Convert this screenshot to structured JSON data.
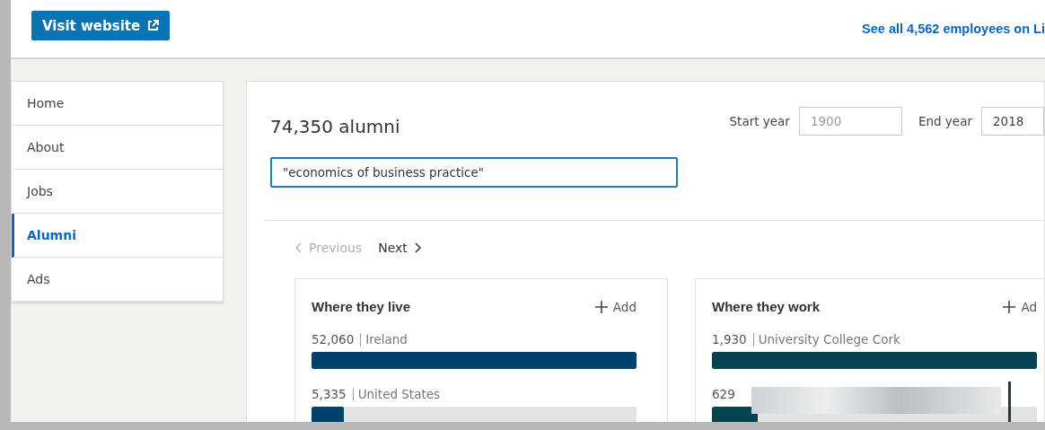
{
  "header": {
    "visit_button": "Visit website",
    "employees_link": "See all 4,562 employees on Li"
  },
  "sidebar": {
    "items": [
      {
        "label": "Home",
        "selected": false
      },
      {
        "label": "About",
        "selected": false
      },
      {
        "label": "Jobs",
        "selected": false
      },
      {
        "label": "Alumni",
        "selected": true
      },
      {
        "label": "Ads",
        "selected": false
      }
    ]
  },
  "alumni": {
    "count": "74,350 alumni",
    "start_year": {
      "label": "Start year",
      "placeholder": "1900"
    },
    "end_year": {
      "label": "End year",
      "value": "2018"
    },
    "search": {
      "value": "\"economics of business practice\""
    },
    "pagination": {
      "previous": {
        "label": "Previous",
        "disabled": true
      },
      "next": {
        "label": "Next",
        "disabled": false
      }
    },
    "cards": [
      {
        "title": "Where they live",
        "add": "Add",
        "color": "#00416b",
        "rows": [
          {
            "count": "52,060",
            "label": "Ireland",
            "level": 1
          },
          {
            "count": "5,335",
            "label": "United States",
            "level": 0.1
          }
        ]
      },
      {
        "title": "Where they work",
        "add": "Ad",
        "color": "#034450",
        "rows": [
          {
            "count": "1,930",
            "label": "University College Cork",
            "level": 1
          },
          {
            "count": "629",
            "level": 0.14
          }
        ]
      }
    ]
  }
}
